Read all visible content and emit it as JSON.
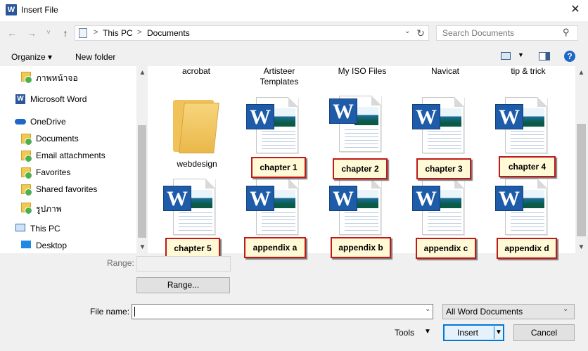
{
  "window": {
    "title": "Insert File",
    "app_icon": "word-icon",
    "close_glyph": "✕"
  },
  "nav": {
    "back": "←",
    "forward": "→",
    "recent": "˅",
    "up": "↑",
    "breadcrumbs": [
      "This PC",
      "Documents"
    ],
    "refresh": "↻",
    "search_placeholder": "Search Documents"
  },
  "toolbar": {
    "organize": "Organize ▾",
    "new_folder": "New folder",
    "help": "?"
  },
  "sidebar": {
    "items": [
      {
        "label": "ภาพหน้าจอ",
        "icon": "synced-folder-icon"
      },
      {
        "label": "Microsoft Word",
        "icon": "word-icon"
      },
      {
        "label": "OneDrive",
        "icon": "cloud-icon"
      },
      {
        "label": "Documents",
        "icon": "synced-folder-icon"
      },
      {
        "label": "Email attachments",
        "icon": "synced-folder-icon"
      },
      {
        "label": "Favorites",
        "icon": "synced-folder-icon"
      },
      {
        "label": "Shared favorites",
        "icon": "synced-folder-icon"
      },
      {
        "label": "รูปภาพ",
        "icon": "synced-folder-icon"
      },
      {
        "label": "This PC",
        "icon": "computer-icon"
      },
      {
        "label": "Desktop",
        "icon": "desktop-icon"
      }
    ]
  },
  "files": {
    "top_row_names": [
      "acrobat",
      "Artisteer Templates",
      "My ISO Files",
      "Navicat",
      "tip & trick"
    ],
    "folder_name": "webdesign",
    "callouts": [
      "chapter 1",
      "chapter 2",
      "chapter 3",
      "chapter 4",
      "chapter 5",
      "appendix a",
      "appendix b",
      "appendix c",
      "appendix d"
    ],
    "word_letter": "W"
  },
  "bottom": {
    "range_label": "Range:",
    "range_button": "Range...",
    "file_name_label": "File name:",
    "file_name_value": "",
    "file_type": "All Word Documents",
    "tools": "Tools",
    "insert": "Insert",
    "cancel": "Cancel",
    "dropdown_glyph": "▼"
  }
}
